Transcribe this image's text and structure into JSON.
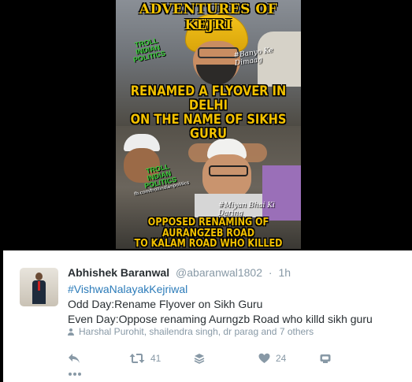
{
  "meme": {
    "title": "ADVENTURES OF KEJRI",
    "caption_top": [
      "RENAMED A FLYOVER IN DELHI",
      "ON THE NAME OF SIKHS GURU"
    ],
    "caption_bottom": [
      "OPPOSED RENAMING OF AURANGZEB ROAD",
      "TO KALAM ROAD WHO KILLED SIKHS GURU"
    ],
    "watermark_lines": [
      "TROLL",
      "INDIAN",
      "POLITICS"
    ],
    "watermark_url": "fb.com/trollindianpolitics",
    "scribble_top": "#Banyo Ke Dimaag",
    "scribble_bottom": "#Miyan Bhai Ki Daring"
  },
  "tweet": {
    "fullname": "Abhishek Baranwal",
    "username": "@abaranwal1802",
    "separator": "·",
    "time": "1h",
    "hashtag": "#VishwaNalayakKejriwal",
    "line1": "Odd Day:Rename Flyover on Sikh Guru",
    "line2": "Even Day:Oppose renaming Aurngzb Road who killd sikh guru",
    "context": "Harshal Purohit, shailendra singh, dr parag and 7 others",
    "retweet_count": "41",
    "like_count": "24"
  },
  "icons": {
    "reply": "reply-icon",
    "retweet": "retweet-icon",
    "buffer": "buffer-stack-icon",
    "like": "heart-icon",
    "extra": "extension-icon",
    "more": "more-dots-icon",
    "context_person": "person-icon"
  },
  "colors": {
    "meme_text": "#f2c100",
    "link": "#2b7bb9",
    "muted": "#8899a6",
    "text": "#292f33"
  }
}
